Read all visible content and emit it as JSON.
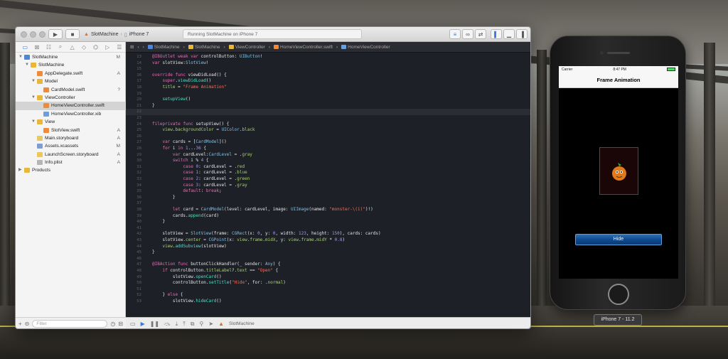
{
  "xcode": {
    "scheme": {
      "project": "SlotMachine",
      "device": "iPhone 7"
    },
    "status": "Running SlotMachine on iPhone 7",
    "jump_bar": [
      "SlotMachine",
      "SlotMachine",
      "ViewController",
      "HomeViewController.swift",
      "HomeViewController"
    ],
    "navigator": {
      "items": [
        {
          "name": "SlotMachine",
          "badge": "M",
          "depth": 0,
          "kind": "project",
          "open": true
        },
        {
          "name": "SlotMachine",
          "badge": "",
          "depth": 1,
          "kind": "folder",
          "open": true
        },
        {
          "name": "AppDelegate.swift",
          "badge": "A",
          "depth": 2,
          "kind": "swift"
        },
        {
          "name": "Model",
          "badge": "",
          "depth": 2,
          "kind": "folder",
          "open": true
        },
        {
          "name": "CardModel.swift",
          "badge": "?",
          "depth": 3,
          "kind": "swift"
        },
        {
          "name": "ViewController",
          "badge": "",
          "depth": 2,
          "kind": "folder",
          "open": true
        },
        {
          "name": "HomeViewController.swift",
          "badge": "",
          "depth": 3,
          "kind": "swift",
          "selected": true
        },
        {
          "name": "HomeViewController.xib",
          "badge": "",
          "depth": 3,
          "kind": "xib"
        },
        {
          "name": "View",
          "badge": "",
          "depth": 2,
          "kind": "folder",
          "open": true
        },
        {
          "name": "SlotView.swift",
          "badge": "A",
          "depth": 3,
          "kind": "swift"
        },
        {
          "name": "Main.storyboard",
          "badge": "A",
          "depth": 2,
          "kind": "storyboard"
        },
        {
          "name": "Assets.xcassets",
          "badge": "M",
          "depth": 2,
          "kind": "assets"
        },
        {
          "name": "LaunchScreen.storyboard",
          "badge": "A",
          "depth": 2,
          "kind": "storyboard"
        },
        {
          "name": "Info.plist",
          "badge": "A",
          "depth": 2,
          "kind": "plist"
        },
        {
          "name": "Products",
          "badge": "",
          "depth": 0,
          "kind": "folder",
          "open": false
        }
      ],
      "filter_placeholder": "Filter"
    },
    "code": {
      "current_line": "22",
      "lines": [
        {
          "n": "13",
          "html": "<span class='kw'>@IBOutlet weak var</span> controlButton: <span class='ty'>UIButton</span>!"
        },
        {
          "n": "14",
          "html": "<span class='kw'>var</span> slotView:<span class='ty'>SlotView</span>!"
        },
        {
          "n": "15",
          "html": ""
        },
        {
          "n": "16",
          "html": "<span class='kw'>override func</span> viewDidLoad() {"
        },
        {
          "n": "17",
          "html": "    <span class='kw'>super</span>.<span class='fn'>viewDidLoad</span>()"
        },
        {
          "n": "18",
          "html": "    <span class='pr'>title</span> = <span class='str'>\"Frame Animation\"</span>"
        },
        {
          "n": "19",
          "html": ""
        },
        {
          "n": "20",
          "html": "    <span class='fn'>setupView</span>()"
        },
        {
          "n": "21",
          "html": "}"
        },
        {
          "n": "22",
          "html": ""
        },
        {
          "n": "23",
          "html": ""
        },
        {
          "n": "24",
          "html": "<span class='kw'>fileprivate func</span> setupView() {"
        },
        {
          "n": "25",
          "html": "    <span class='pr'>view</span>.<span class='pr'>backgroundColor</span> = <span class='ty'>UIColor</span>.<span class='pr'>black</span>"
        },
        {
          "n": "26",
          "html": ""
        },
        {
          "n": "27",
          "html": "    <span class='kw'>var</span> cards = [<span class='ty'>CardModel</span>]()"
        },
        {
          "n": "28",
          "html": "    <span class='kw'>for</span> i <span class='kw'>in</span> <span class='num'>1</span>...<span class='num'>36</span> {"
        },
        {
          "n": "29",
          "html": "        <span class='kw'>var</span> cardLevel:<span class='ty'>CardLevel</span> = .<span class='pr'>gray</span>"
        },
        {
          "n": "30",
          "html": "        <span class='kw'>switch</span> i % <span class='num'>4</span> {"
        },
        {
          "n": "31",
          "html": "            <span class='kw'>case</span> <span class='num'>0</span>: cardLevel = .<span class='pr'>red</span>"
        },
        {
          "n": "32",
          "html": "            <span class='kw'>case</span> <span class='num'>1</span>: cardLevel = .<span class='pr'>blue</span>"
        },
        {
          "n": "33",
          "html": "            <span class='kw'>case</span> <span class='num'>2</span>: cardLevel = .<span class='pr'>green</span>"
        },
        {
          "n": "34",
          "html": "            <span class='kw'>case</span> <span class='num'>3</span>: cardLevel = .<span class='pr'>gray</span>"
        },
        {
          "n": "35",
          "html": "            <span class='kw'>default</span>: <span class='kw'>break</span>;"
        },
        {
          "n": "36",
          "html": "        }"
        },
        {
          "n": "37",
          "html": ""
        },
        {
          "n": "38",
          "html": "        <span class='kw'>let</span> card = <span class='ty'>CardModel</span>(level: cardLevel, image: <span class='ty'>UIImage</span>(named: <span class='str'>\"monster-\\(i)\"</span>)!)"
        },
        {
          "n": "39",
          "html": "        cards.<span class='fn'>append</span>(card)"
        },
        {
          "n": "40",
          "html": "    }"
        },
        {
          "n": "41",
          "html": ""
        },
        {
          "n": "42",
          "html": "    slotView = <span class='ty'>SlotView</span>(frame: <span class='ty'>CGRect</span>(x: <span class='num'>0</span>, y: <span class='num'>0</span>, width: <span class='num'>123</span>, height: <span class='num'>150</span>), cards: cards)"
        },
        {
          "n": "43",
          "html": "    slotView.<span class='pr'>center</span> = <span class='ty'>CGPoint</span>(x: <span class='pr'>view</span>.<span class='pr'>frame</span>.<span class='pr'>midX</span>, y: <span class='pr'>view</span>.<span class='pr'>frame</span>.<span class='pr'>midY</span> * <span class='num'>0.8</span>)"
        },
        {
          "n": "44",
          "html": "    <span class='pr'>view</span>.<span class='fn'>addSubview</span>(slotView)"
        },
        {
          "n": "45",
          "html": "}"
        },
        {
          "n": "46",
          "html": ""
        },
        {
          "n": "47",
          "html": "<span class='kw'>@IBAction func</span> buttonClickHandler(_ sender: <span class='ty'>Any</span>) {"
        },
        {
          "n": "48",
          "html": "    <span class='kw'>if</span> controlButton.<span class='pr'>titleLabel</span>?.<span class='pr'>text</span> == <span class='str'>\"Open\"</span> {"
        },
        {
          "n": "49",
          "html": "        slotView.<span class='fn'>openCard</span>()"
        },
        {
          "n": "50",
          "html": "        controlButton.<span class='fn'>setTitle</span>(<span class='str'>\"Hide\"</span>, for: .<span class='pr'>normal</span>)"
        },
        {
          "n": "51",
          "html": ""
        },
        {
          "n": "52",
          "html": "    } <span class='kw'>else</span> {"
        },
        {
          "n": "53",
          "html": "        slotView.<span class='fn'>hideCard</span>()"
        }
      ]
    },
    "debug_bar": {
      "label": "SlotMachine"
    }
  },
  "simulator": {
    "status": {
      "carrier": "Carrier",
      "time": "8:47 PM"
    },
    "nav_title": "Frame Animation",
    "button_label": "Hide",
    "device_label": "iPhone 7 - 11.2"
  },
  "colors": {
    "accent": "#2f6fb3",
    "card_border": "#b0201e",
    "editor_bg": "#1e2027"
  }
}
